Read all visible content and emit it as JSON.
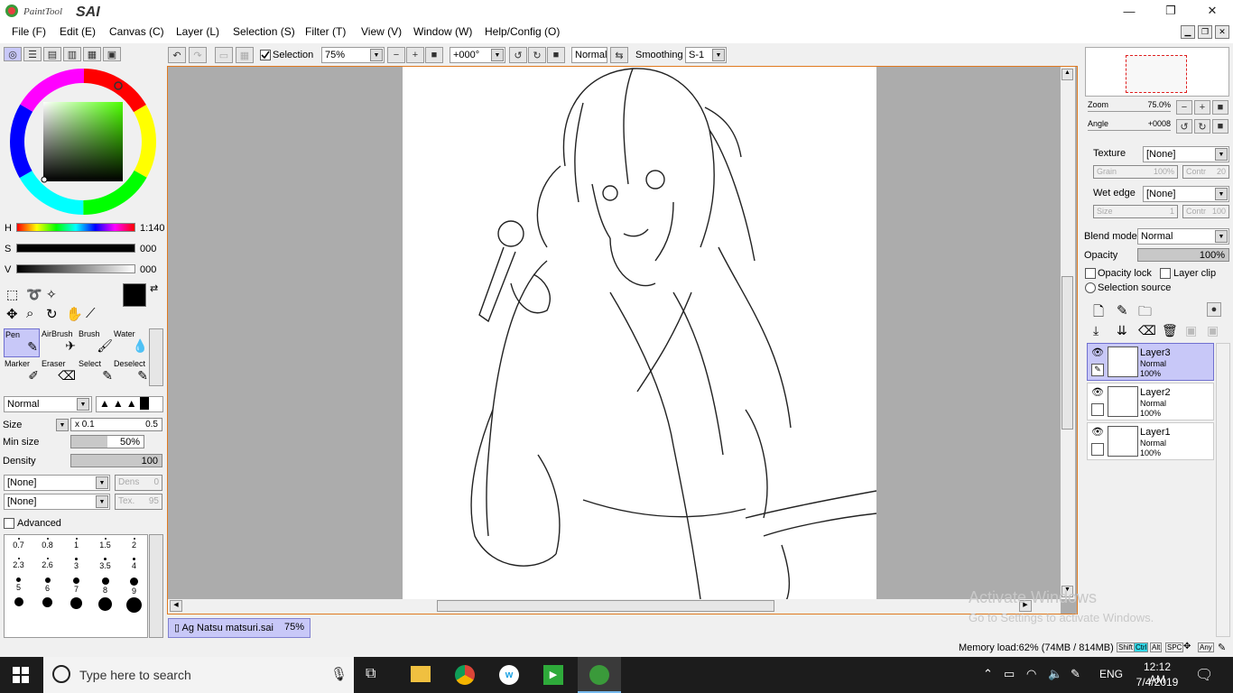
{
  "app": {
    "logo_text": "PaintTool SAI",
    "file_name": "Ag Natsu matsuri.sai",
    "tab_zoom": "75%"
  },
  "menu": [
    "File (F)",
    "Edit (E)",
    "Canvas (C)",
    "Layer (L)",
    "Selection (S)",
    "Filter (T)",
    "View (V)",
    "Window (W)",
    "Help/Config (O)"
  ],
  "toolbar": {
    "selection_label": "Selection",
    "zoom_value": "75%",
    "angle_value": "+000°",
    "blend_value": "Normal",
    "smoothing_label": "Smoothing",
    "smoothing_value": "S-1"
  },
  "color": {
    "h_label": "H",
    "h_value": "1:140",
    "s_label": "S",
    "s_value": "000",
    "v_label": "V",
    "v_value": "000",
    "foreground": "#000000"
  },
  "tools": [
    {
      "label": "Pen",
      "selected": true
    },
    {
      "label": "AirBrush"
    },
    {
      "label": "Brush"
    },
    {
      "label": "Water"
    },
    {
      "label": "Marker"
    },
    {
      "label": "Eraser"
    },
    {
      "label": "Select"
    },
    {
      "label": "Deselect"
    }
  ],
  "brush": {
    "mode": "Normal",
    "size_label": "Size",
    "size_mult": "x 0.1",
    "size_value": "0.5",
    "minsize_label": "Min size",
    "minsize_value": "50%",
    "density_label": "Density",
    "density_value": "100",
    "texture1": "[None]",
    "dens_label": "Dens",
    "dens_value": "0",
    "texture2": "[None]",
    "tex_label": "Tex.",
    "tex_value": "95",
    "advanced_label": "Advanced",
    "sizes": [
      "0.7",
      "0.8",
      "1",
      "1.5",
      "2",
      "2.3",
      "2.6",
      "3",
      "3.5",
      "4",
      "5",
      "6",
      "7",
      "8",
      "9",
      "",
      "",
      "",
      "",
      ""
    ]
  },
  "navigator": {
    "zoom_label": "Zoom",
    "zoom_value": "75.0%",
    "angle_label": "Angle",
    "angle_value": "+0008"
  },
  "props": {
    "texture_label": "Texture",
    "texture_value": "[None]",
    "grain_label": "Grain",
    "grain_value": "100%",
    "contr_label": "Contr",
    "contr_value": "20",
    "wetedge_label": "Wet edge",
    "wetedge_value": "[None]",
    "size_label": "Size",
    "size_value": "1",
    "contr2_label": "Contr",
    "contr2_value": "100",
    "blend_label": "Blend mode",
    "blend_value": "Normal",
    "opacity_label": "Opacity",
    "opacity_value": "100%",
    "opacity_lock": "Opacity lock",
    "layer_clip": "Layer clip",
    "selection_source": "Selection source"
  },
  "layers": [
    {
      "name": "Layer3",
      "mode": "Normal",
      "opacity": "100%",
      "selected": true
    },
    {
      "name": "Layer2",
      "mode": "Normal",
      "opacity": "100%"
    },
    {
      "name": "Layer1",
      "mode": "Normal",
      "opacity": "100%"
    }
  ],
  "status": {
    "memory": "Memory load:62% (74MB / 814MB)",
    "keys": [
      "Shift",
      "Ctrl",
      "Alt",
      "SPC",
      "Any"
    ]
  },
  "watermark": {
    "title": "Activate Windows",
    "subtitle": "Go to Settings to activate Windows."
  },
  "taskbar": {
    "search_placeholder": "Type here to search",
    "lang": "ENG",
    "time": "12:12 AM",
    "date": "7/4/2019"
  }
}
